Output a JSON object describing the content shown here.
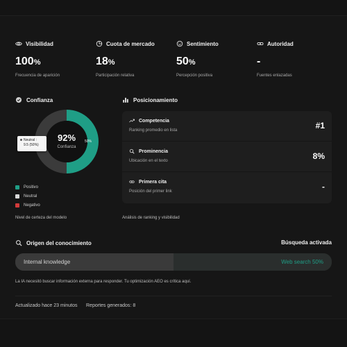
{
  "metrics": [
    {
      "label": "Visibilidad",
      "value": "100",
      "unit": "%",
      "sub": "Frecuencia de aparición",
      "icon": "eye-icon"
    },
    {
      "label": "Cuota de mercado",
      "value": "18",
      "unit": "%",
      "sub": "Participación relativa",
      "icon": "pie-chart-icon"
    },
    {
      "label": "Sentimiento",
      "value": "50",
      "unit": "%",
      "sub": "Percepción positiva",
      "icon": "smile-icon"
    },
    {
      "label": "Autoridad",
      "value": "-",
      "unit": "",
      "sub": "Fuentes enlazadas",
      "icon": "link-icon"
    }
  ],
  "confianza": {
    "title": "Confianza",
    "center_value": "92%",
    "center_label": "Confianza",
    "segment_label": "50%",
    "tooltip_line": "Neutral :",
    "tooltip_value": "9.5 (50%)",
    "legend": [
      {
        "label": "Positivo",
        "color": "#1f9e86"
      },
      {
        "label": "Neutral",
        "color": "#d8d8d8"
      },
      {
        "label": "Negativo",
        "color": "#d23a3a"
      }
    ],
    "caption": "Nivel de certeza del modelo"
  },
  "chart_data": {
    "type": "pie",
    "categories": [
      "Positivo",
      "Neutral"
    ],
    "values": [
      9.5,
      9.5
    ],
    "colors": [
      "#1f9e86",
      "#3b3b3b"
    ]
  },
  "posicionamiento": {
    "title": "Posicionamiento",
    "rows": [
      {
        "title": "Competencia",
        "sub": "Ranking promedio en lista",
        "value": "#1",
        "icon": "trending-up-icon"
      },
      {
        "title": "Prominencia",
        "sub": "Ubicación en el texto",
        "value": "8%",
        "icon": "search-icon"
      },
      {
        "title": "Primera cita",
        "sub": "Posición del primer link",
        "value": "-",
        "icon": "link-icon"
      }
    ],
    "caption": "Análisis de ranking y visibilidad"
  },
  "conocimiento": {
    "title": "Origen del conocimiento",
    "status": "Búsqueda activada",
    "left_label": "Internal knowledge",
    "right_label": "Web search 50%",
    "web_share": 0.5,
    "note": "La IA necesitó buscar información externa para responder. Tu optimización AEO es crítica aquí."
  },
  "footer": {
    "updated": "Actualizado hace 23 minutos",
    "reports": "Reportes generados: 8"
  }
}
